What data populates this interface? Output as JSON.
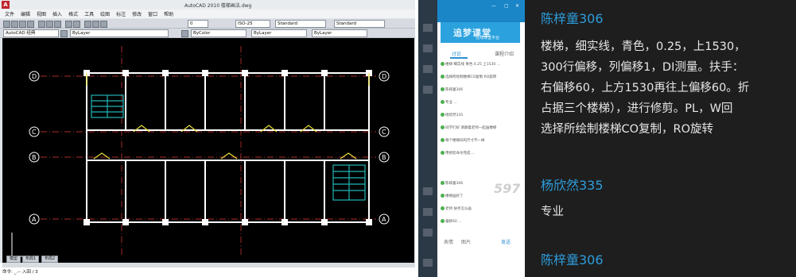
{
  "cad": {
    "title": "AutoCAD 2010  楼梯画法.dwg",
    "logo": "A",
    "menus": [
      "文件",
      "编辑",
      "视图",
      "插入",
      "格式",
      "工具",
      "绘图",
      "标注",
      "修改",
      "窗口",
      "帮助"
    ],
    "toolbar1": {
      "layer": "0",
      "scale": "ISO-25",
      "textstyle": "Standard",
      "dimstyle": "Standard"
    },
    "toolbar2": {
      "workspace": "AutoCAD 经典",
      "layer_current": "ByLayer",
      "linetype": "ByLayer",
      "color": "ByColor"
    },
    "axis_labels": [
      "D",
      "C",
      "B",
      "A"
    ],
    "cmd_tabs": [
      "模型",
      "布局1",
      "布局2"
    ],
    "command_line": "命令: _.-- 入回 / 3",
    "colors": {
      "drawing_bg": "#000000",
      "wall": "#ffffff",
      "axis": "#e03c3c",
      "stair": "#22b5b5",
      "window": "#e8e03a"
    }
  },
  "chat": {
    "banner": "追梦课堂",
    "banner_sub": "在线课堂平台",
    "tabs": [
      "讨论",
      "课程介绍"
    ],
    "messages": [
      "楼梯 细实线 青色 0.25 上1530 ...",
      "选择所绘制楼梯CO复制 RO旋转",
      "陈梓童306",
      "专业 ...",
      "杨欣然335",
      "同学们好 请跟着老师一起画楼梯",
      "每个楼梯间的尺寸不一样",
      "用修剪命令完成 ...",
      "陈梓童306",
      "楼梯画好了",
      "老师 扶手怎么画",
      "偏移60 ..."
    ],
    "watermark": "597",
    "bottom_icons": [
      "表情",
      "图片",
      "发送"
    ]
  },
  "panel": {
    "entries": [
      {
        "user": "陈梓童306",
        "lines": [
          "楼梯，细实线，青色，0.25，上1530，",
          "300行偏移，列偏移1，DI测量。扶手：",
          "右偏移60，上方1530再往上偏移60。折",
          "占据三个楼梯），进行修剪。PL，W回",
          "选择所绘制楼梯CO复制，RO旋转"
        ]
      },
      {
        "user": "杨欣然335",
        "lines": [
          "专业"
        ]
      },
      {
        "user": "陈梓童306",
        "lines": []
      }
    ],
    "colors": {
      "bg": "#1e1e1e",
      "username": "#2d9cdb",
      "text": "#e6e6e6"
    }
  }
}
